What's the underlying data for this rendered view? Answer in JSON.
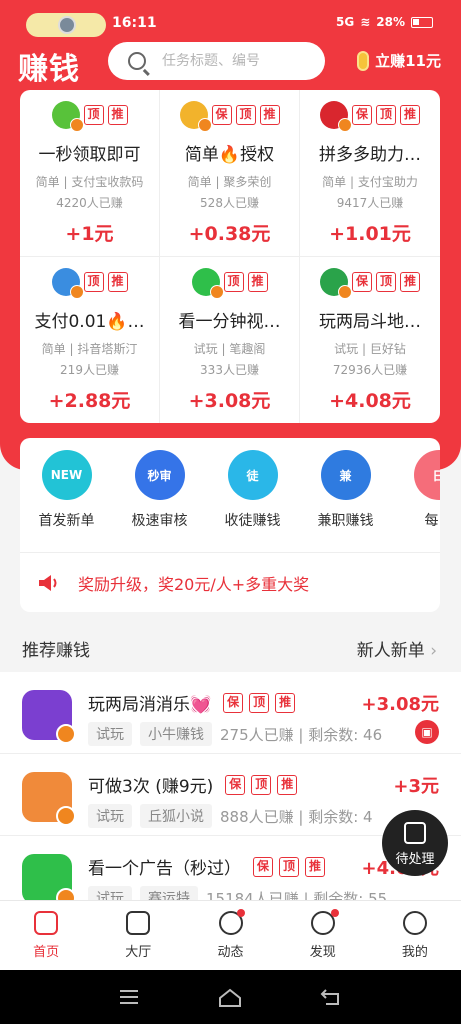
{
  "status": {
    "time": "16:11",
    "battery": "28%",
    "network": "5G"
  },
  "header": {
    "logo": "赚钱",
    "search_placeholder": "任务标题、编号",
    "earn_label": "立赚11元"
  },
  "tasks": [
    {
      "title": "一秒领取即可",
      "sub": "简单 | 支付宝收款码",
      "count": "4220人已赚",
      "price": "+1元",
      "tags": [
        "顶",
        "推"
      ],
      "avatar": "#58c23a"
    },
    {
      "title": "简单🔥授权",
      "sub": "简单 | 聚多荣创",
      "count": "528人已赚",
      "price": "+0.38元",
      "tags": [
        "保",
        "顶",
        "推"
      ],
      "avatar": "#f2b32c"
    },
    {
      "title": "拼多多助力…",
      "sub": "简单 | 支付宝助力",
      "count": "9417人已赚",
      "price": "+1.01元",
      "tags": [
        "保",
        "顶",
        "推"
      ],
      "avatar": "#d9262e"
    },
    {
      "title": "支付0.01🔥…",
      "sub": "简单 | 抖音塔斯汀",
      "count": "219人已赚",
      "price": "+2.88元",
      "tags": [
        "顶",
        "推"
      ],
      "avatar": "#3a8de0"
    },
    {
      "title": "看一分钟视…",
      "sub": "试玩 | 笔趣阁",
      "count": "333人已赚",
      "price": "+3.08元",
      "tags": [
        "顶",
        "推"
      ],
      "avatar": "#2fbf4a"
    },
    {
      "title": "玩两局斗地…",
      "sub": "试玩 | 巨好钻",
      "count": "72936人已赚",
      "price": "+4.08元",
      "tags": [
        "保",
        "顶",
        "推"
      ],
      "avatar": "#2aa34a"
    }
  ],
  "categories": [
    {
      "label": "首发新单",
      "color": "#22c3d6",
      "icon": "NEW"
    },
    {
      "label": "极速审核",
      "color": "#3574e8",
      "icon": "秒审"
    },
    {
      "label": "收徒赚钱",
      "color": "#2ab7e8",
      "icon": "徒"
    },
    {
      "label": "兼职赚钱",
      "color": "#2f7be0",
      "icon": "兼"
    },
    {
      "label": "每日",
      "color": "#f56d7a",
      "icon": "日"
    }
  ],
  "notice": "奖励升级，奖20元/人+多重大奖",
  "recommend": {
    "title": "推荐赚钱",
    "more": "新人新单"
  },
  "list": [
    {
      "title": "玩两局消消乐💓",
      "tags": [
        "保",
        "顶",
        "推"
      ],
      "price": "+3.08元",
      "chips": [
        "试玩",
        "小牛赚钱"
      ],
      "meta": "275人已赚 | 剩余数: 46",
      "avatar": "#7b3fd0"
    },
    {
      "title": "可做3次 (赚9元)",
      "tags": [
        "保",
        "顶",
        "推"
      ],
      "price": "+3元",
      "chips": [
        "试玩",
        "丘狐小说"
      ],
      "meta": "888人已赚 | 剩余数: 4",
      "avatar": "#f08a3a"
    },
    {
      "title": "看一个广告（秒过）",
      "tags": [
        "保",
        "顶",
        "推"
      ],
      "price": "+4.08元",
      "chips": [
        "试玩",
        "赛运特"
      ],
      "meta": "15184人已赚 | 剩余数: 55",
      "avatar": "#2fbf4a"
    }
  ],
  "pending": "待处理",
  "tabs": [
    "首页",
    "大厅",
    "动态",
    "发现",
    "我的"
  ]
}
